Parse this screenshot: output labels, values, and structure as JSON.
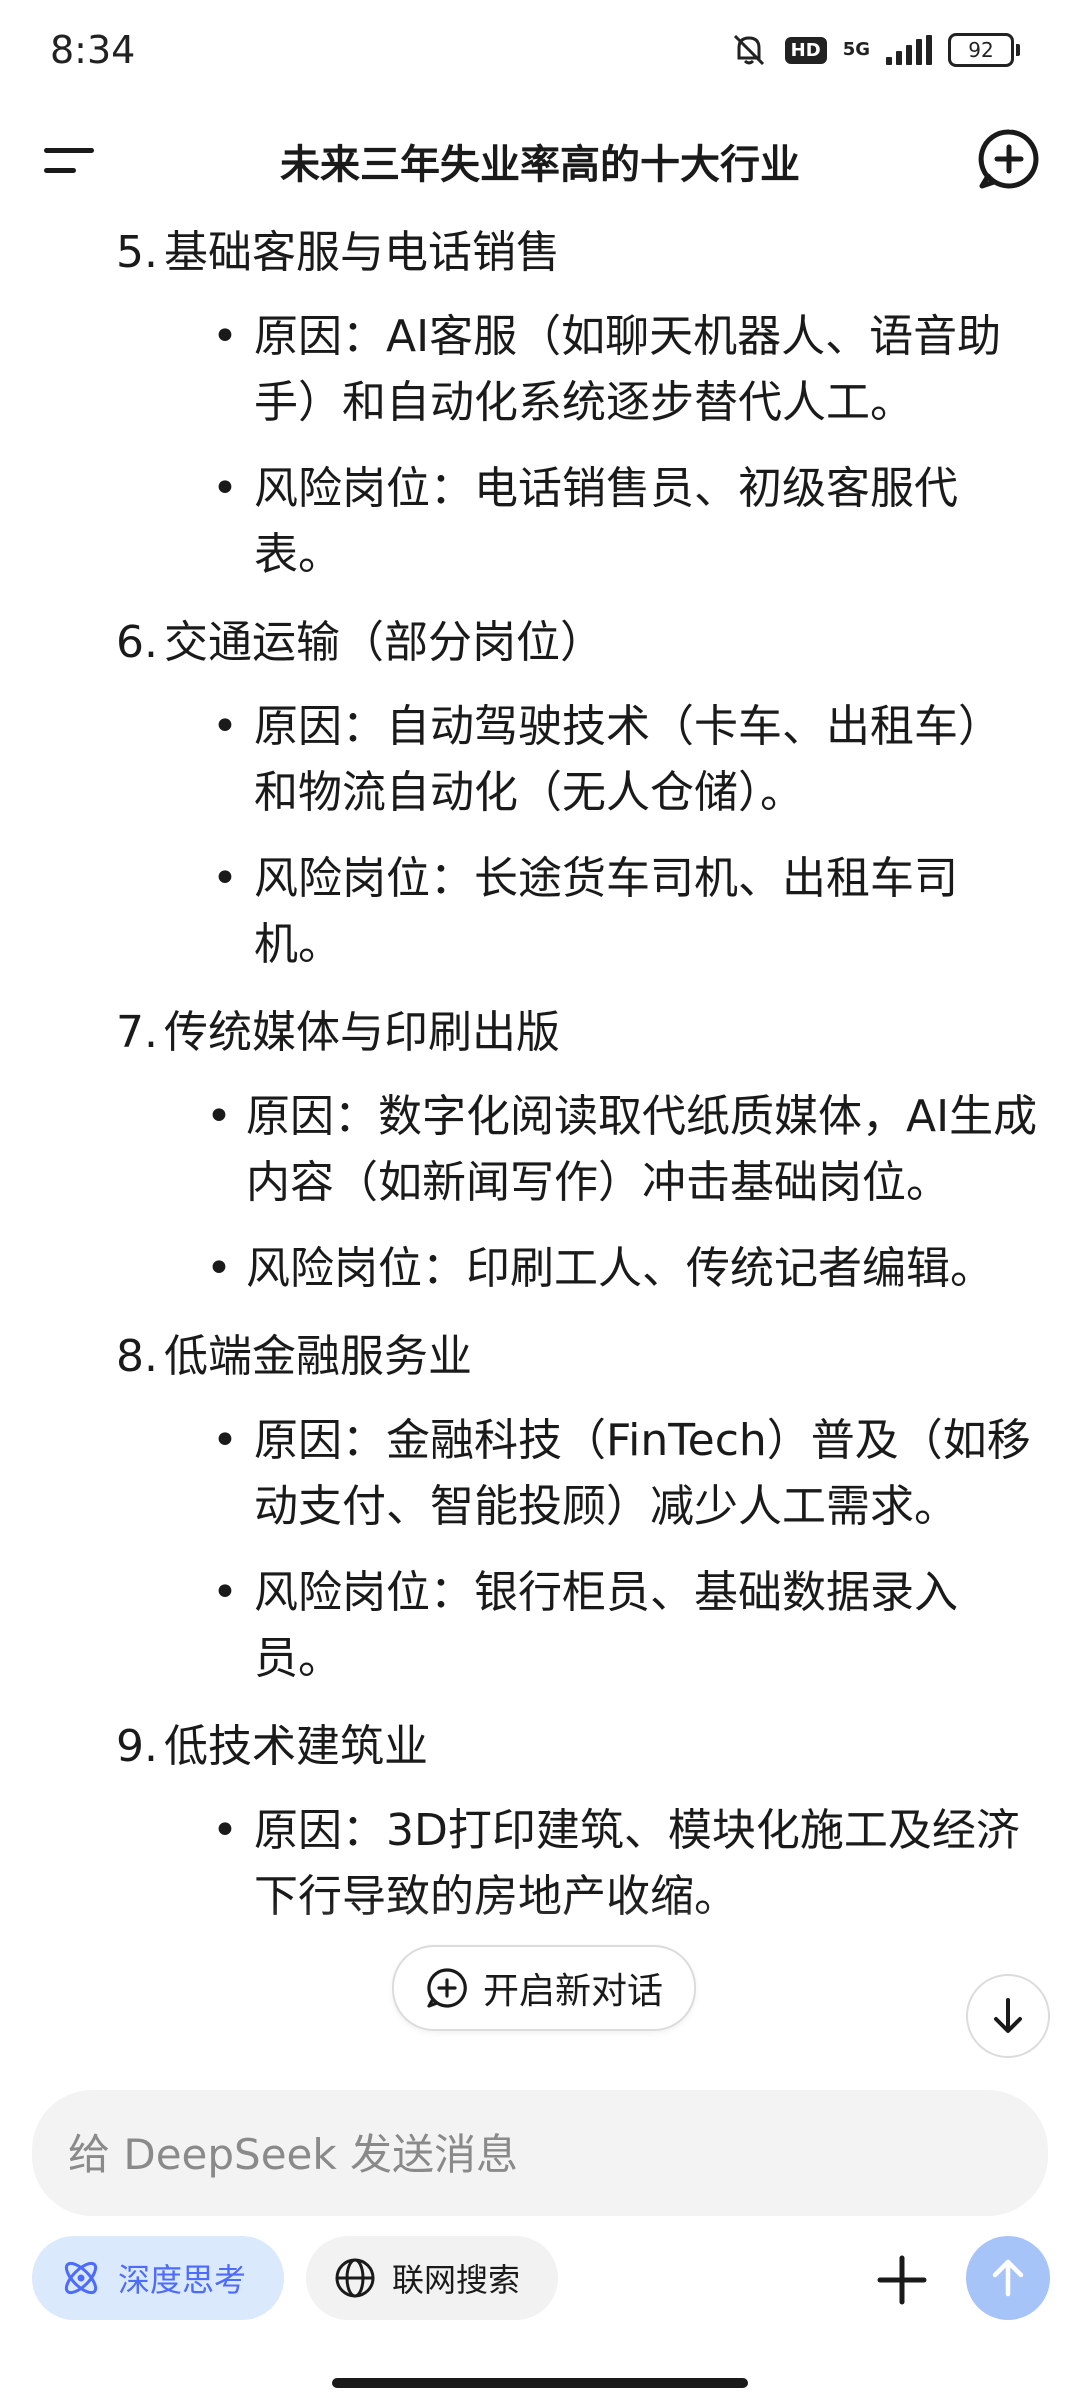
{
  "status_bar": {
    "time": "8:34",
    "hd": "HD",
    "network": "5G",
    "battery": "92"
  },
  "header": {
    "title": "未来三年失业率高的十大行业"
  },
  "sections": [
    {
      "num": "5.",
      "title": "基础客服与电话销售",
      "bullets": [
        "原因：AI客服（如聊天机器人、语音助手）和自动化系统逐步替代人工。",
        "风险岗位：电话销售员、初级客服代表。"
      ]
    },
    {
      "num": "6.",
      "title": "交通运输（部分岗位）",
      "bullets": [
        "原因：自动驾驶技术（卡车、出租车）和物流自动化（无人仓储）。",
        "风险岗位：长途货车司机、出租车司机。"
      ]
    },
    {
      "num": "7.",
      "title": "传统媒体与印刷出版",
      "bullets": [
        "原因：数字化阅读取代纸质媒体，AI生成内容（如新闻写作）冲击基础岗位。",
        "风险岗位：印刷工人、传统记者编辑。"
      ]
    },
    {
      "num": "8.",
      "title": "低端金融服务业",
      "bullets": [
        "原因：金融科技（FinTech）普及（如移动支付、智能投顾）减少人工需求。",
        "风险岗位：银行柜员、基础数据录入员。"
      ]
    },
    {
      "num": "9.",
      "title": "低技术建筑业",
      "bullets": [
        "原因：3D打印建筑、模块化施工及经济下行导致的房地产收缩。"
      ]
    }
  ],
  "floating": {
    "new_chat_label": "开启新对话"
  },
  "input": {
    "placeholder": "给 DeepSeek 发送消息",
    "value": ""
  },
  "toolbar": {
    "deep_think_label": "深度思考",
    "web_search_label": "联网搜索"
  },
  "colors": {
    "accent": "#4d6bfe",
    "deep_think_bg": "#dbe9fd",
    "send_button": "#a7c4f8"
  },
  "icons": {
    "menu": "menu-icon",
    "new_chat": "new-chat-icon",
    "scroll_down": "arrow-down-icon",
    "deep_think": "atom-icon",
    "web_search": "globe-icon",
    "attach": "plus-icon",
    "send": "arrow-up-icon"
  }
}
